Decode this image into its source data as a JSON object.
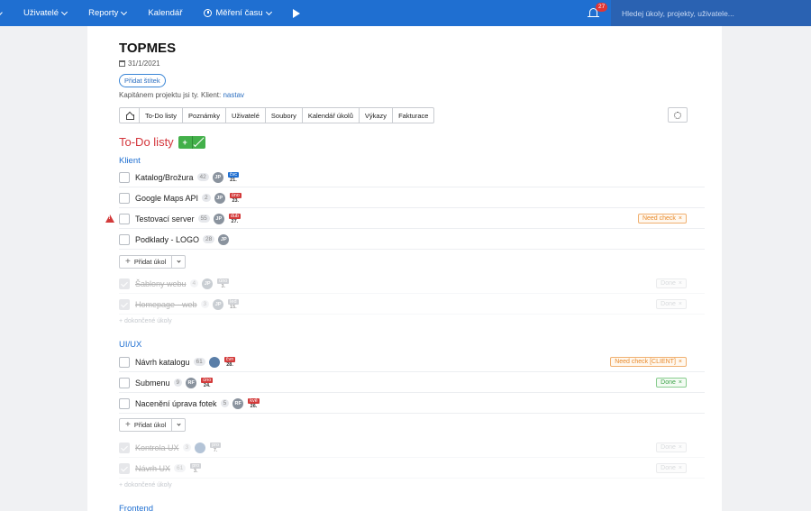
{
  "nav": {
    "items": [
      {
        "label": "Uživatelé",
        "caret": true
      },
      {
        "label": "Reporty",
        "caret": true
      },
      {
        "label": "Kalendář",
        "caret": false
      },
      {
        "label": "Měření času",
        "caret": true
      }
    ],
    "notifications": "27",
    "search_placeholder": "Hledej úkoly, projekty, uživatele..."
  },
  "project": {
    "title": "TOPMES",
    "date": "31/1/2021",
    "tag_button": "Přidat štítek",
    "captain_text": "Kapitánem projektu jsi ty. Klient: ",
    "captain_link": "nastav"
  },
  "tabs": [
    "To-Do listy",
    "Poznámky",
    "Uživatelé",
    "Soubory",
    "Kalendář úkolů",
    "Výkazy",
    "Fakturace"
  ],
  "section_title": "To-Do listy",
  "add_task_label": "Přidat úkol",
  "more_completed": "+ dokončené úkoly",
  "lists": [
    {
      "title": "Klient",
      "tasks": [
        {
          "name": "Katalog/Brožura",
          "count": "42",
          "avatar": "JP",
          "due_m": "čvc",
          "due_d": "21.",
          "due_color": "blue",
          "status": ""
        },
        {
          "name": "Google Maps API",
          "count": "2",
          "avatar": "JP",
          "due_m": "úno",
          "due_d": "23.",
          "due_color": "red",
          "status": ""
        },
        {
          "name": "Testovací server",
          "count": "55",
          "avatar": "JP",
          "due_m": "dub",
          "due_d": "27.",
          "due_color": "red",
          "status": "Need check",
          "status_color": "orange",
          "warning": true
        },
        {
          "name": "Podklady - LOGO",
          "count": "28",
          "avatar": "JP",
          "due_m": "",
          "due_d": "",
          "due_color": "",
          "status": ""
        }
      ],
      "done": [
        {
          "name": "Šablony webu",
          "count": "4",
          "avatar": "JP",
          "due_m": "úno",
          "due_d": "3.",
          "status": "Done"
        },
        {
          "name": "Homepage - web",
          "count": "3",
          "avatar": "JP",
          "due_m": "led",
          "due_d": "15.",
          "status": "Done"
        }
      ]
    },
    {
      "title": "UI/UX",
      "tasks": [
        {
          "name": "Návrh katalogu",
          "count": "61",
          "avatar": "",
          "due_m": "čvn",
          "due_d": "28.",
          "due_color": "red",
          "status": "Need check [CLIENT]",
          "status_color": "orange"
        },
        {
          "name": "Submenu",
          "count": "9",
          "avatar": "RF",
          "due_m": "úno",
          "due_d": "24.",
          "due_color": "red",
          "status": "Done",
          "status_color": "green"
        },
        {
          "name": "Nacenění úprava fotek",
          "count": "5",
          "avatar": "RF",
          "due_m": "kvě",
          "due_d": "26.",
          "due_color": "red",
          "status": ""
        }
      ],
      "done": [
        {
          "name": "Kontrola UX",
          "count": "3",
          "avatar": "",
          "due_m": "pro",
          "due_d": "7.",
          "status": "Done"
        },
        {
          "name": "Návrh UX",
          "count": "61",
          "avatar": "",
          "due_m": "pro",
          "due_d": "3.",
          "status": "Done"
        }
      ]
    }
  ],
  "next_list_title": "Frontend"
}
